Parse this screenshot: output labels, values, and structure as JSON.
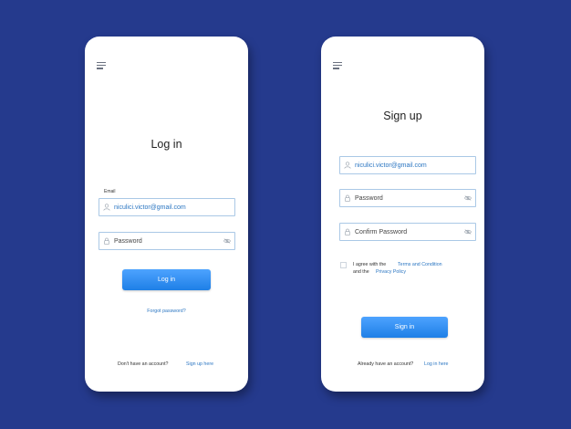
{
  "colors": {
    "background": "#253a8d",
    "accent": "#1e7fe6",
    "link": "#2b76c2",
    "input_border": "#aac8e6"
  },
  "login": {
    "title": "Log in",
    "email_label": "Email",
    "email_value": "niculici.victor@gmail.com",
    "password_placeholder": "Password",
    "login_button": "Log in",
    "forgot_password": "Forgot password?",
    "no_account": "Don't have an account?",
    "sign_up_link": "Sign up here"
  },
  "signup": {
    "title": "Sign up",
    "email_value": "niculici.victor@gmail.com",
    "password_placeholder": "Password",
    "confirm_password_placeholder": "Confirm Password",
    "agree_text": "I agree with the",
    "terms_link": "Terms and Condition",
    "and_text": "and the",
    "privacy_link": "Privacy Policy",
    "signin_button": "Sign in",
    "have_account": "Already have an account?",
    "log_in_link": "Log in here"
  },
  "icons": [
    "menu-icon",
    "user-icon",
    "lock-icon",
    "eye-off-icon"
  ]
}
